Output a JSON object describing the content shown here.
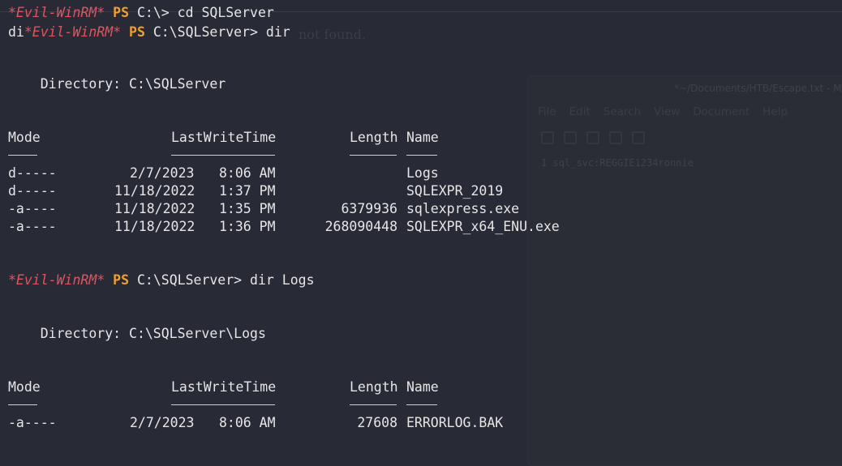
{
  "background_window": {
    "title": "*~/Documents/HTB/Escape.txt - Ma",
    "menu": [
      "File",
      "Edit",
      "Search",
      "View",
      "Document",
      "Help"
    ],
    "line_number": "1",
    "text": "sql_svc:REGGIE1234ronnie"
  },
  "ghost_text": "not found.",
  "prompt": {
    "shell": "*Evil-WinRM*",
    "ps": "PS"
  },
  "commands": {
    "cmd1_path": "C:\\>",
    "cmd1": "cd SQLServer",
    "cmd2_prefix": "di",
    "cmd2_path": "C:\\SQLServer>",
    "cmd2": "dir",
    "cmd3_path": "C:\\SQLServer>",
    "cmd3": "dir Logs"
  },
  "listing1": {
    "directory": "    Directory: C:\\SQLServer",
    "headers": {
      "mode": "Mode",
      "lwt": "LastWriteTime",
      "length": "Length",
      "name": "Name"
    },
    "rows": [
      {
        "mode": "d-----",
        "date": "2/7/2023",
        "time": "8:06 AM",
        "length": "",
        "name": "Logs"
      },
      {
        "mode": "d-----",
        "date": "11/18/2022",
        "time": "1:37 PM",
        "length": "",
        "name": "SQLEXPR_2019"
      },
      {
        "mode": "-a----",
        "date": "11/18/2022",
        "time": "1:35 PM",
        "length": "6379936",
        "name": "sqlexpress.exe"
      },
      {
        "mode": "-a----",
        "date": "11/18/2022",
        "time": "1:36 PM",
        "length": "268090448",
        "name": "SQLEXPR_x64_ENU.exe"
      }
    ]
  },
  "listing2": {
    "directory": "    Directory: C:\\SQLServer\\Logs",
    "headers": {
      "mode": "Mode",
      "lwt": "LastWriteTime",
      "length": "Length",
      "name": "Name"
    },
    "rows": [
      {
        "mode": "-a----",
        "date": "2/7/2023",
        "time": "8:06 AM",
        "length": "27608",
        "name": "ERRORLOG.BAK"
      }
    ]
  },
  "colors": {
    "prompt_red": "#e05561",
    "ps_orange": "#f0a030",
    "bg": "#282a35"
  }
}
